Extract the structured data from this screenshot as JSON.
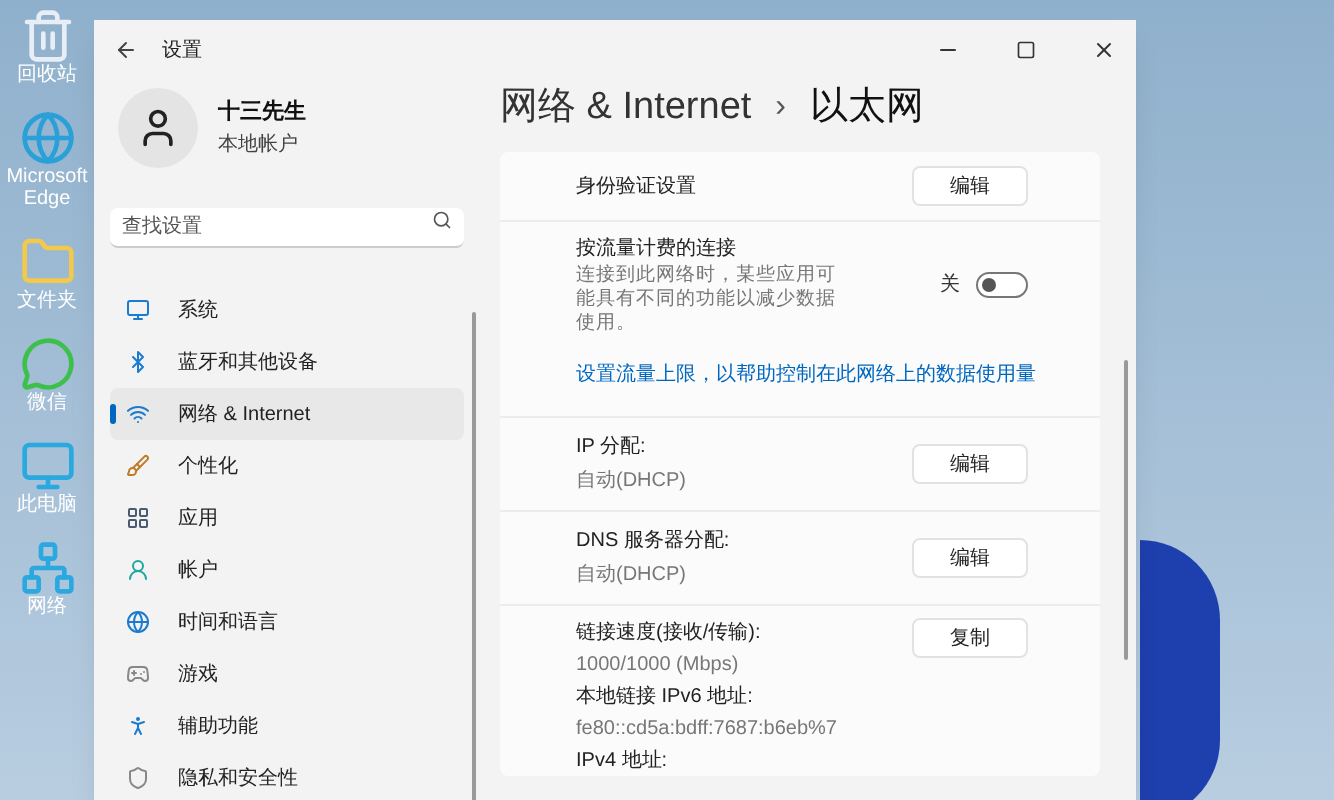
{
  "desktop_icons": [
    {
      "label": "回收站",
      "kind": "bin"
    },
    {
      "label": "Microsoft Edge",
      "kind": "edge"
    },
    {
      "label": "文件夹",
      "kind": "folder"
    },
    {
      "label": "微信",
      "kind": "chat"
    },
    {
      "label": "此电脑",
      "kind": "pc"
    },
    {
      "label": "网络",
      "kind": "network"
    }
  ],
  "window": {
    "title": "设置"
  },
  "account": {
    "name": "十三先生",
    "type": "本地帐户"
  },
  "search": {
    "placeholder": "查找设置"
  },
  "sidebar": {
    "items": [
      {
        "label": "系统",
        "kind": "system",
        "selected": false
      },
      {
        "label": "蓝牙和其他设备",
        "kind": "bluetooth",
        "selected": false
      },
      {
        "label": "网络 & Internet",
        "kind": "network",
        "selected": true
      },
      {
        "label": "个性化",
        "kind": "brush",
        "selected": false
      },
      {
        "label": "应用",
        "kind": "apps",
        "selected": false
      },
      {
        "label": "帐户",
        "kind": "account",
        "selected": false
      },
      {
        "label": "时间和语言",
        "kind": "time",
        "selected": false
      },
      {
        "label": "游戏",
        "kind": "game",
        "selected": false
      },
      {
        "label": "辅助功能",
        "kind": "access",
        "selected": false
      },
      {
        "label": "隐私和安全性",
        "kind": "privacy",
        "selected": false
      }
    ]
  },
  "breadcrumb": {
    "parent": "网络 & Internet",
    "separator": "›",
    "current": "以太网"
  },
  "rows": [
    {
      "kind": "button",
      "title": "身份验证设置",
      "button": "编辑"
    },
    {
      "kind": "toggle",
      "title": "按流量计费的连接",
      "description": "连接到此网络时，某些应用可能具有不同的功能以减少数据使用。",
      "state_label": "关",
      "on": false
    },
    {
      "kind": "link",
      "text": "设置流量上限，以帮助控制在此网络上的数据使用量"
    },
    {
      "kind": "button",
      "title": "IP 分配:",
      "value": "自动(DHCP)",
      "button": "编辑"
    },
    {
      "kind": "button",
      "title": "DNS 服务器分配:",
      "value": "自动(DHCP)",
      "button": "编辑"
    },
    {
      "kind": "details",
      "button": "复制",
      "pairs": [
        {
          "label": "链接速度(接收/传输):",
          "value": "1000/1000 (Mbps)"
        },
        {
          "label": "本地链接 IPv6 地址:",
          "value": "fe80::cd5a:bdff:7687:b6eb%7"
        },
        {
          "label": "IPv4 地址:"
        }
      ]
    }
  ]
}
